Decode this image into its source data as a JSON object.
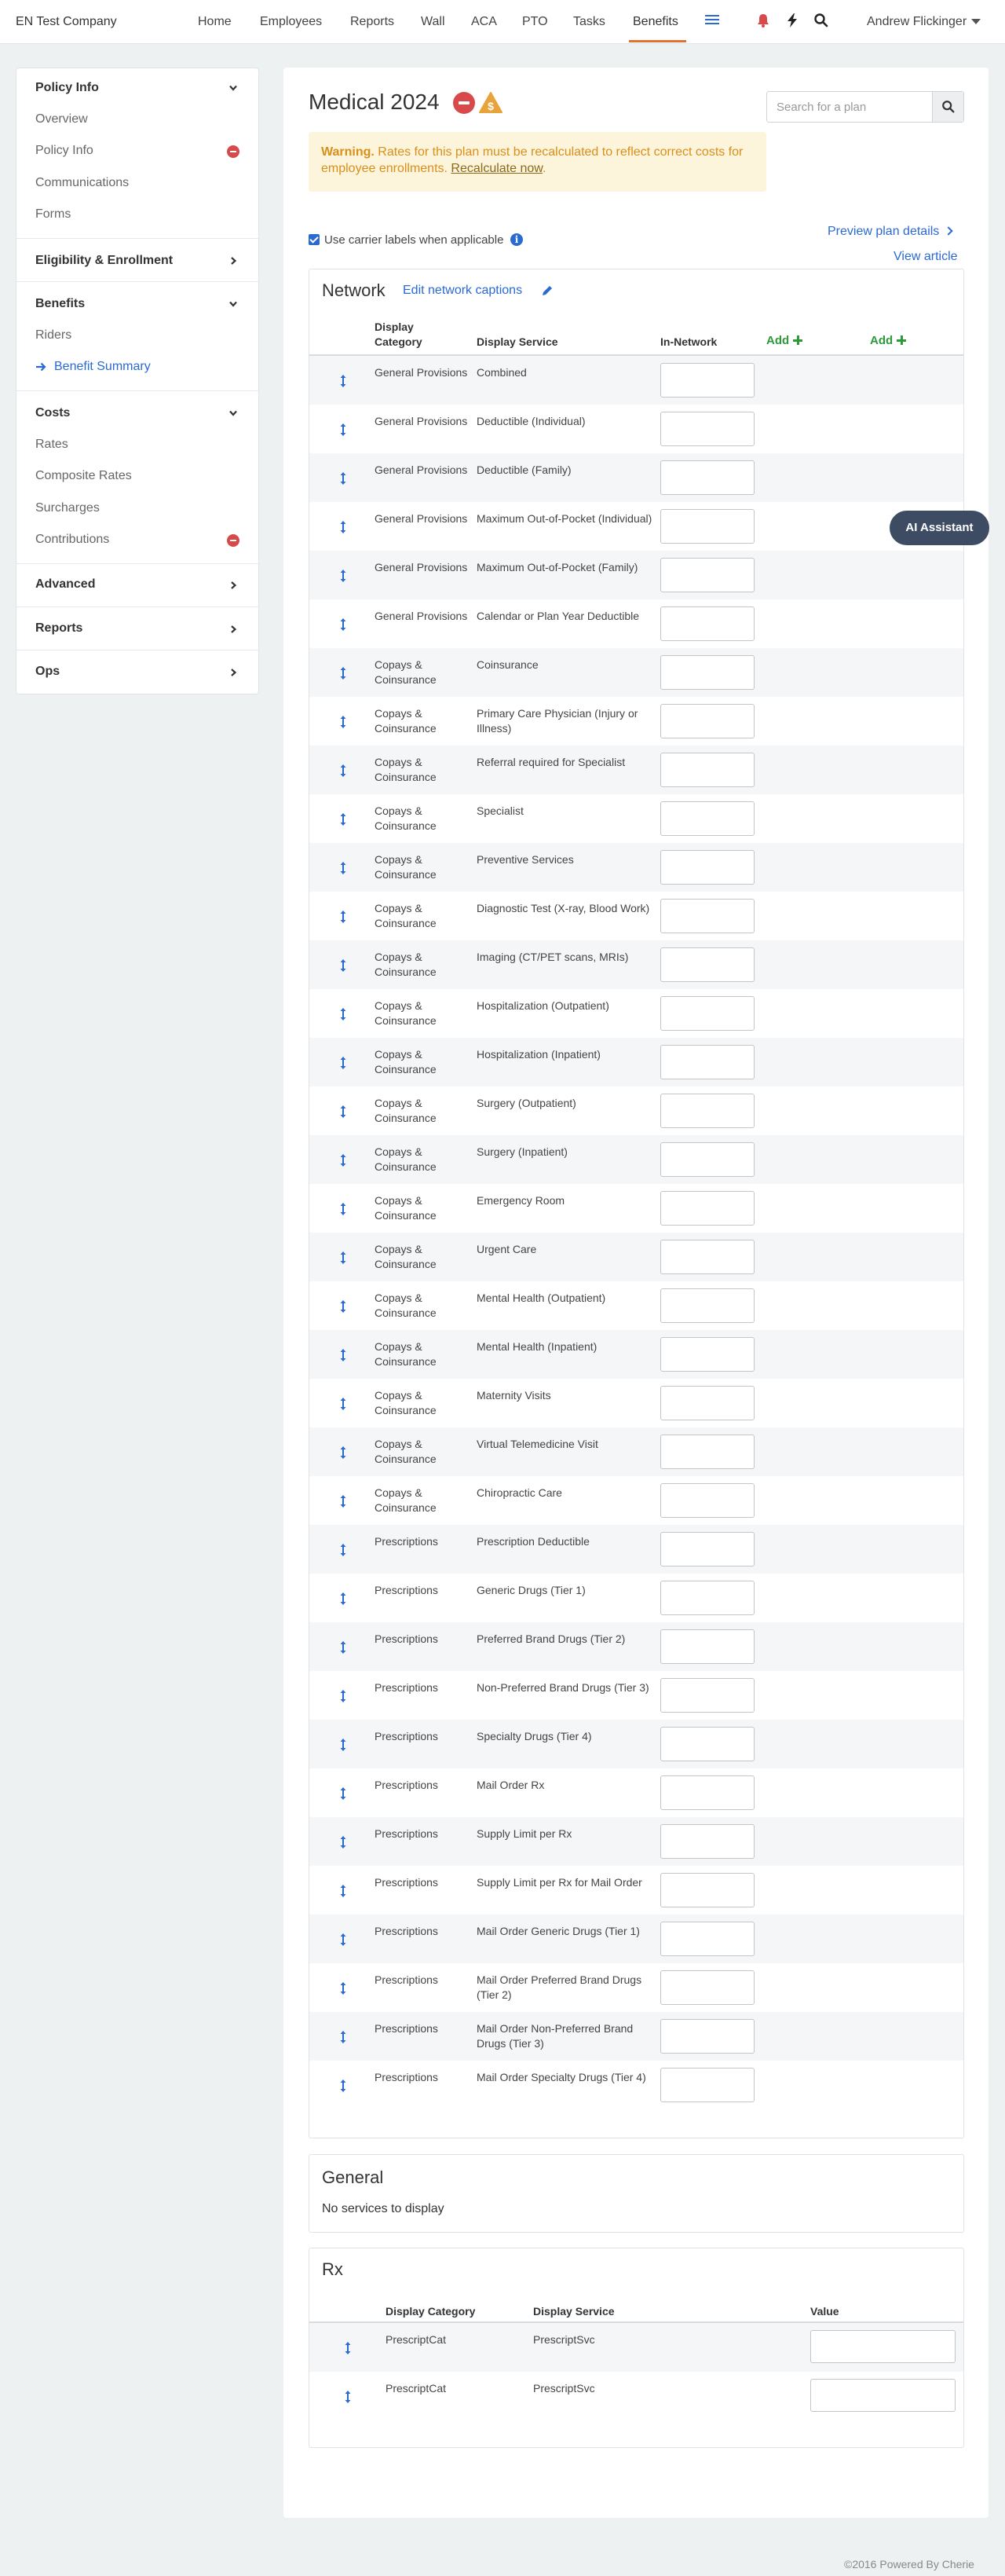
{
  "company": "EN Test Company",
  "nav": {
    "items": [
      "Home",
      "Employees",
      "Reports",
      "Wall",
      "ACA",
      "PTO",
      "Tasks",
      "Benefits"
    ],
    "active": "Benefits",
    "user": "Andrew Flickinger"
  },
  "sidebar": {
    "policy_info": "Policy Info",
    "overview": "Overview",
    "policy_info_item": "Policy Info",
    "communications": "Communications",
    "forms": "Forms",
    "eligibility": "Eligibility & Enrollment",
    "benefits": "Benefits",
    "riders": "Riders",
    "benefit_summary": "Benefit Summary",
    "costs": "Costs",
    "rates": "Rates",
    "composite_rates": "Composite Rates",
    "surcharges": "Surcharges",
    "contributions": "Contributions",
    "advanced": "Advanced",
    "reports": "Reports",
    "ops": "Ops"
  },
  "main": {
    "title": "Medical 2024",
    "search_placeholder": "Search for a plan",
    "warning_strong": "Warning.",
    "warning_text": " Rates for this plan must be recalculated to reflect correct costs for employee enrollments.",
    "recalculate_link": "Recalculate now",
    "warning_end": ".",
    "checkbox_label": "Use carrier labels when applicable",
    "info_glyph": "i",
    "preview_link": "Preview plan details",
    "view_article": "View article"
  },
  "network": {
    "title": "Network",
    "edit_captions": "Edit network captions",
    "headers": {
      "category": "Display Category",
      "service": "Display Service",
      "in_network": "In-Network",
      "add1": "Add",
      "add2": "Add"
    },
    "rows": [
      {
        "cat": "General Provisions",
        "svc": "Combined"
      },
      {
        "cat": "General Provisions",
        "svc": "Deductible (Individual)"
      },
      {
        "cat": "General Provisions",
        "svc": "Deductible (Family)"
      },
      {
        "cat": "General Provisions",
        "svc": "Maximum Out-of-Pocket (Individual)"
      },
      {
        "cat": "General Provisions",
        "svc": "Maximum Out-of-Pocket (Family)"
      },
      {
        "cat": "General Provisions",
        "svc": "Calendar or Plan Year Deductible"
      },
      {
        "cat": "Copays & Coinsurance",
        "svc": "Coinsurance"
      },
      {
        "cat": "Copays & Coinsurance",
        "svc": "Primary Care Physician (Injury or Illness)"
      },
      {
        "cat": "Copays & Coinsurance",
        "svc": "Referral required for Specialist"
      },
      {
        "cat": "Copays & Coinsurance",
        "svc": "Specialist"
      },
      {
        "cat": "Copays & Coinsurance",
        "svc": "Preventive Services"
      },
      {
        "cat": "Copays & Coinsurance",
        "svc": "Diagnostic Test (X-ray, Blood Work)"
      },
      {
        "cat": "Copays & Coinsurance",
        "svc": "Imaging (CT/PET scans, MRIs)"
      },
      {
        "cat": "Copays & Coinsurance",
        "svc": "Hospitalization (Outpatient)"
      },
      {
        "cat": "Copays & Coinsurance",
        "svc": "Hospitalization (Inpatient)"
      },
      {
        "cat": "Copays & Coinsurance",
        "svc": "Surgery (Outpatient)"
      },
      {
        "cat": "Copays & Coinsurance",
        "svc": "Surgery (Inpatient)"
      },
      {
        "cat": "Copays & Coinsurance",
        "svc": "Emergency Room"
      },
      {
        "cat": "Copays & Coinsurance",
        "svc": "Urgent Care"
      },
      {
        "cat": "Copays & Coinsurance",
        "svc": "Mental Health (Outpatient)"
      },
      {
        "cat": "Copays & Coinsurance",
        "svc": "Mental Health (Inpatient)"
      },
      {
        "cat": "Copays & Coinsurance",
        "svc": "Maternity Visits"
      },
      {
        "cat": "Copays & Coinsurance",
        "svc": "Virtual Telemedicine Visit"
      },
      {
        "cat": "Copays & Coinsurance",
        "svc": "Chiropractic Care"
      },
      {
        "cat": "Prescriptions",
        "svc": "Prescription Deductible"
      },
      {
        "cat": "Prescriptions",
        "svc": "Generic Drugs (Tier 1)"
      },
      {
        "cat": "Prescriptions",
        "svc": "Preferred Brand Drugs (Tier 2)"
      },
      {
        "cat": "Prescriptions",
        "svc": "Non-Preferred Brand Drugs (Tier 3)"
      },
      {
        "cat": "Prescriptions",
        "svc": "Specialty Drugs (Tier 4)"
      },
      {
        "cat": "Prescriptions",
        "svc": "Mail Order Rx"
      },
      {
        "cat": "Prescriptions",
        "svc": "Supply Limit per Rx"
      },
      {
        "cat": "Prescriptions",
        "svc": "Supply Limit per Rx for Mail Order"
      },
      {
        "cat": "Prescriptions",
        "svc": "Mail Order Generic Drugs (Tier 1)"
      },
      {
        "cat": "Prescriptions",
        "svc": "Mail Order Preferred Brand Drugs (Tier 2)"
      },
      {
        "cat": "Prescriptions",
        "svc": "Mail Order Non-Preferred Brand Drugs (Tier 3)"
      },
      {
        "cat": "Prescriptions",
        "svc": "Mail Order Specialty Drugs (Tier 4)"
      }
    ]
  },
  "general": {
    "title": "General",
    "empty": "No services to display"
  },
  "rx": {
    "title": "Rx",
    "headers": {
      "category": "Display Category",
      "service": "Display Service",
      "value": "Value"
    },
    "rows": [
      {
        "cat": "PrescriptCat",
        "svc": "PrescriptSvc"
      },
      {
        "cat": "PrescriptCat",
        "svc": "PrescriptSvc"
      }
    ]
  },
  "ai_assistant": "AI Assistant",
  "footer": "©2016 Powered By Cherie",
  "icons": {
    "bell": "bell-icon",
    "bolt": "bolt-icon",
    "search": "search-icon",
    "menu": "menu-icon",
    "warning": "dollar-warning-icon",
    "pencil": "pencil-icon",
    "handle": "sort-handle-icon"
  },
  "colors": {
    "accent": "#2a6ad3",
    "nav_active_underline": "#e2702f",
    "danger": "#d84a4a",
    "warning_text": "#d98f1a",
    "warning_bg": "#fdf4dc",
    "add_green": "#2d9a3a",
    "ai_button": "#3d4b63"
  }
}
